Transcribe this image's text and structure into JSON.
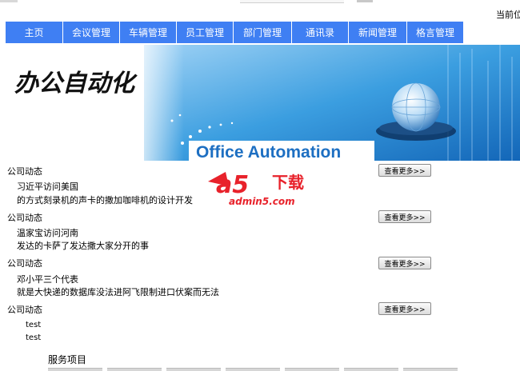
{
  "header": {
    "location_label": "当前位"
  },
  "nav": {
    "items": [
      "主页",
      "会议管理",
      "车辆管理",
      "员工管理",
      "部门管理",
      "通讯录",
      "新闻管理",
      "格言管理"
    ]
  },
  "banner": {
    "calligraphy": "办公自动化",
    "subtitle": "Office Automation"
  },
  "news_sections": [
    {
      "title": "公司动态",
      "lines": [
        "习近平访问美国",
        "的方式刻录机的声卡的撒加咖啡机的设计开发"
      ],
      "more_label": "查看更多>>"
    },
    {
      "title": "公司动态",
      "lines": [
        "温家宝访问河南",
        "发达的卡萨了发达撒大家分开的事"
      ],
      "more_label": "查看更多>>"
    },
    {
      "title": "公司动态",
      "lines": [
        "邓小平三个代表",
        "就是大快递的数据库没法进阿飞限制进口伏案而无法"
      ],
      "more_label": "查看更多>>"
    },
    {
      "title": "公司动态",
      "lines": [
        "test",
        "test"
      ],
      "more_label": "查看更多>>"
    }
  ],
  "services": {
    "title": "服务项目"
  },
  "watermark": {
    "logo_text": "a5",
    "brand": "下载",
    "domain": "admin5.com"
  },
  "colors": {
    "nav_bg": "#3f7ff3",
    "nav_text": "#ffffff",
    "banner_blue": "#2a8fd8",
    "watermark_red": "#e8222b"
  }
}
